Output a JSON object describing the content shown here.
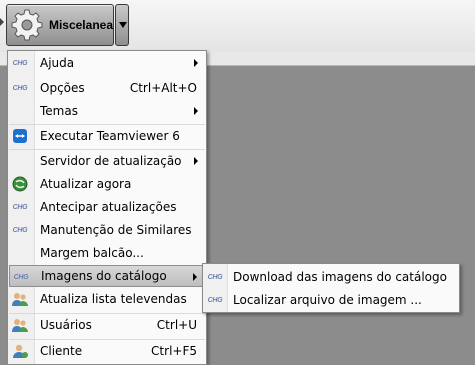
{
  "toolbar": {
    "button_label": "Miscelanea",
    "button_icon": "gear-icon"
  },
  "menu": {
    "items": [
      {
        "label": "Ajuda",
        "shortcut": "",
        "submenu": true,
        "icon": "chg-icon"
      },
      {
        "label": "Opções",
        "shortcut": "Ctrl+Alt+O",
        "submenu": false,
        "icon": "chg-icon"
      },
      {
        "label": "Temas",
        "shortcut": "",
        "submenu": true,
        "icon": ""
      },
      {
        "label": "Executar Teamviewer 6",
        "shortcut": "",
        "submenu": false,
        "icon": "teamviewer-icon"
      },
      {
        "label": "Servidor de atualização",
        "shortcut": "",
        "submenu": true,
        "icon": ""
      },
      {
        "label": "Atualizar agora",
        "shortcut": "",
        "submenu": false,
        "icon": "globe-refresh-icon"
      },
      {
        "label": "Antecipar atualizações",
        "shortcut": "",
        "submenu": false,
        "icon": "chg-icon"
      },
      {
        "label": "Manutenção de Similares",
        "shortcut": "",
        "submenu": false,
        "icon": "chg-icon"
      },
      {
        "label": "Margem balcão...",
        "shortcut": "",
        "submenu": false,
        "icon": ""
      },
      {
        "label": "Imagens do catálogo",
        "shortcut": "",
        "submenu": true,
        "icon": "chg-icon"
      },
      {
        "label": "Atualiza lista televendas",
        "shortcut": "",
        "submenu": false,
        "icon": "users-icon"
      },
      {
        "label": "Usuários",
        "shortcut": "Ctrl+U",
        "submenu": false,
        "icon": "users-icon"
      },
      {
        "label": "Cliente",
        "shortcut": "Ctrl+F5",
        "submenu": false,
        "icon": "user-client-icon"
      }
    ],
    "icon_text": "CHG"
  },
  "submenu": {
    "items": [
      {
        "label": "Download das imagens do catálogo",
        "icon": "chg-icon"
      },
      {
        "label": "Localizar arquivo de imagem ...",
        "icon": "chg-icon"
      }
    ]
  }
}
